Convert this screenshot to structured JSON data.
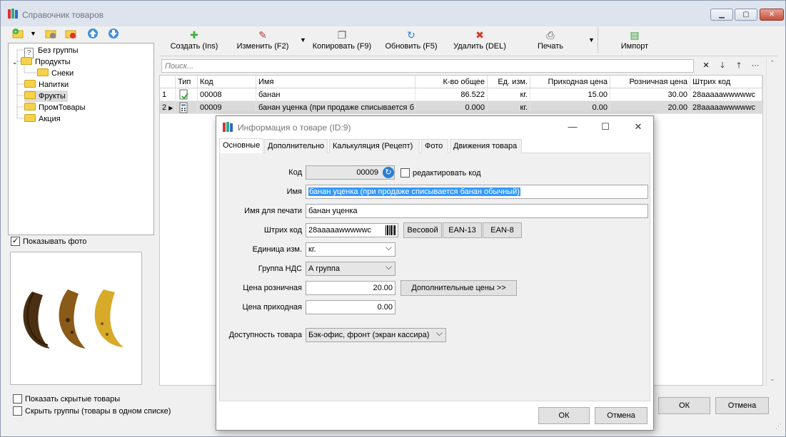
{
  "main": {
    "title": "Справочник товаров",
    "controls": {
      "minimize": "▁",
      "maximize": "▢",
      "close": "✕"
    }
  },
  "left_toolbar": {
    "icons": [
      "add-group-icon",
      "dropdown-arrow-icon",
      "group-settings-icon",
      "delete-group-icon",
      "move-up-icon",
      "move-down-icon"
    ]
  },
  "tree": {
    "items": [
      {
        "label": "Без группы",
        "icon": "question-icon"
      },
      {
        "label": "Продукты",
        "icon": "folder-icon"
      },
      {
        "label": "Снеки",
        "icon": "folder-icon"
      },
      {
        "label": "Напитки",
        "icon": "folder-icon"
      },
      {
        "label": "Фрукты",
        "icon": "folder-icon"
      },
      {
        "label": "ПромТовары",
        "icon": "folder-icon"
      },
      {
        "label": "Акция",
        "icon": "folder-icon"
      }
    ]
  },
  "photo": {
    "show_photo_label": "Показывать фото",
    "checked": true
  },
  "bottom_checks": {
    "show_hidden": "Показать скрытые товары",
    "hide_groups": "Скрыть группы (товары в одном списке)"
  },
  "toolbar": {
    "create": "Создать (Ins)",
    "edit": "Изменить (F2)",
    "copy": "Копировать (F9)",
    "refresh": "Обновить (F5)",
    "delete": "Удалить (DEL)",
    "print": "Печать",
    "import": "Импорт"
  },
  "search": {
    "placeholder": "Поиск...",
    "clear": "✕",
    "down": "🡓",
    "up": "🡑",
    "more": "···"
  },
  "grid": {
    "headers": [
      "Тип",
      "Код",
      "Имя",
      "К-во общее",
      "Ед. изм.",
      "Приходная цена",
      "Розничная цена",
      "Штрих код"
    ],
    "rows": [
      {
        "num": "1",
        "marker": "",
        "code": "00008",
        "name": "банан",
        "qty": "86.522",
        "unit": "кг.",
        "in_price": "15.00",
        "retail": "30.00",
        "barcode": "28aaaaawwwwwc"
      },
      {
        "num": "2",
        "marker": "▶",
        "code": "00009",
        "name": "банан уценка (при продаже списывается б",
        "qty": "0.000",
        "unit": "кг.",
        "in_price": "0.00",
        "retail": "20.00",
        "barcode": "28aaaaawwwwwc"
      }
    ]
  },
  "main_buttons": {
    "ok": "ОК",
    "cancel": "Отмена"
  },
  "dialog": {
    "title": "Информация о товаре (ID:9)",
    "controls": {
      "minimize": "—",
      "maximize": "☐",
      "close": "✕"
    },
    "tabs": [
      "Основные",
      "Дополнительно",
      "Калькуляция (Рецепт)",
      "Фото",
      "Движения товара"
    ],
    "fields": {
      "code_label": "Код",
      "code_value": "00009",
      "edit_code_label": "редактировать код",
      "name_label": "Имя",
      "name_value": "банан уценка (при продаже списывается банан обычный)",
      "print_name_label": "Имя для печати",
      "print_name_value": "банан уценка",
      "barcode_label": "Штрих код",
      "barcode_value": "28aaaaawwwwwc",
      "barcode_buttons": [
        "Весовой",
        "EAN-13",
        "EAN-8"
      ],
      "unit_label": "Единица изм.",
      "unit_value": "кг.",
      "vat_label": "Группа НДС",
      "vat_value": "А группа",
      "retail_label": "Цена розничная",
      "retail_value": "20.00",
      "extra_prices": "Дополнительные цены >>",
      "in_price_label": "Цена приходная",
      "in_price_value": "0.00",
      "availability_label": "Доступность товара",
      "availability_value": "Бэк-офис, фронт (экран кассира)"
    },
    "ok": "ОК",
    "cancel": "Отмена"
  }
}
